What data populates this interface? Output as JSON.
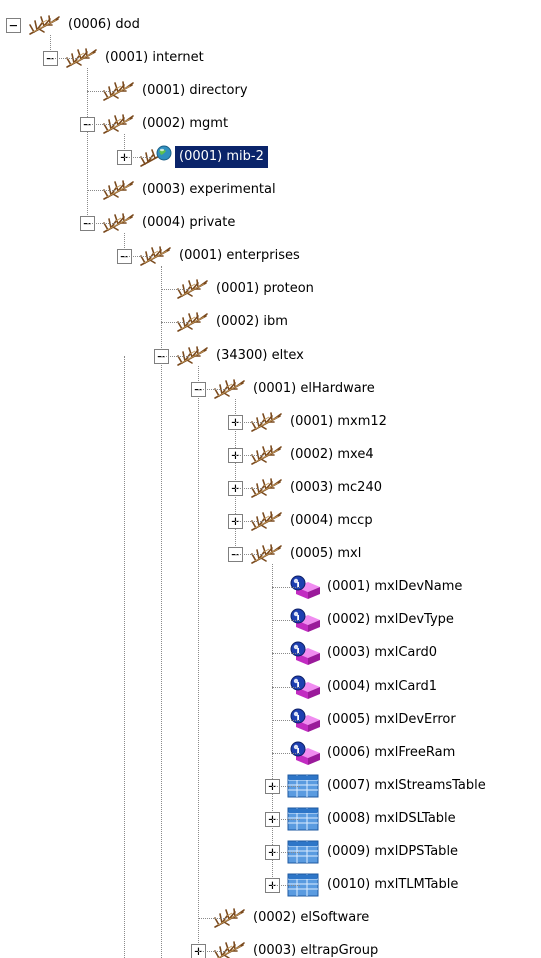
{
  "tree": {
    "nodes": [
      {
        "label": "(0006) dod",
        "icon": "branch-icon",
        "toggle": "collapse"
      },
      {
        "label": "(0001) internet",
        "icon": "branch-icon",
        "toggle": "collapse"
      },
      {
        "label": "(0001) directory",
        "icon": "branch-icon",
        "toggle": ""
      },
      {
        "label": "(0002) mgmt",
        "icon": "branch-icon",
        "toggle": "collapse"
      },
      {
        "label": "(0001) mib-2",
        "icon": "branch-globe-icon",
        "toggle": "expand",
        "selected": true
      },
      {
        "label": "(0003) experimental",
        "icon": "branch-icon",
        "toggle": ""
      },
      {
        "label": "(0004) private",
        "icon": "branch-icon",
        "toggle": "collapse"
      },
      {
        "label": "(0001) enterprises",
        "icon": "branch-icon",
        "toggle": "collapse"
      },
      {
        "label": "(0001) proteon",
        "icon": "branch-icon",
        "toggle": ""
      },
      {
        "label": "(0002) ibm",
        "icon": "branch-icon",
        "toggle": ""
      },
      {
        "label": "(34300) eltex",
        "icon": "branch-icon",
        "toggle": "collapse"
      },
      {
        "label": "(0001) elHardware",
        "icon": "branch-icon",
        "toggle": "collapse"
      },
      {
        "label": "(0001) mxm12",
        "icon": "branch-icon",
        "toggle": "expand"
      },
      {
        "label": "(0002) mxe4",
        "icon": "branch-icon",
        "toggle": "expand"
      },
      {
        "label": "(0003) mc240",
        "icon": "branch-icon",
        "toggle": "expand"
      },
      {
        "label": "(0004) mccp",
        "icon": "branch-icon",
        "toggle": "expand"
      },
      {
        "label": "(0005) mxl",
        "icon": "branch-icon",
        "toggle": "collapse"
      },
      {
        "label": "(0001) mxlDevName",
        "icon": "scalar-object-icon",
        "toggle": ""
      },
      {
        "label": "(0002) mxlDevType",
        "icon": "scalar-object-icon",
        "toggle": ""
      },
      {
        "label": "(0003) mxlCard0",
        "icon": "scalar-object-icon",
        "toggle": ""
      },
      {
        "label": "(0004) mxlCard1",
        "icon": "scalar-object-icon",
        "toggle": ""
      },
      {
        "label": "(0005) mxlDevError",
        "icon": "scalar-object-icon",
        "toggle": ""
      },
      {
        "label": "(0006) mxlFreeRam",
        "icon": "scalar-object-icon",
        "toggle": ""
      },
      {
        "label": "(0007) mxlStreamsTable",
        "icon": "table-icon",
        "toggle": "expand"
      },
      {
        "label": "(0008) mxlDSLTable",
        "icon": "table-icon",
        "toggle": "expand"
      },
      {
        "label": "(0009) mxlDPSTable",
        "icon": "table-icon",
        "toggle": "expand"
      },
      {
        "label": "(0010) mxlTLMTable",
        "icon": "table-icon",
        "toggle": "expand"
      },
      {
        "label": "(0002) elSoftware",
        "icon": "branch-icon",
        "toggle": ""
      },
      {
        "label": "(0003) eltrapGroup",
        "icon": "branch-icon",
        "toggle": "expand"
      }
    ]
  }
}
